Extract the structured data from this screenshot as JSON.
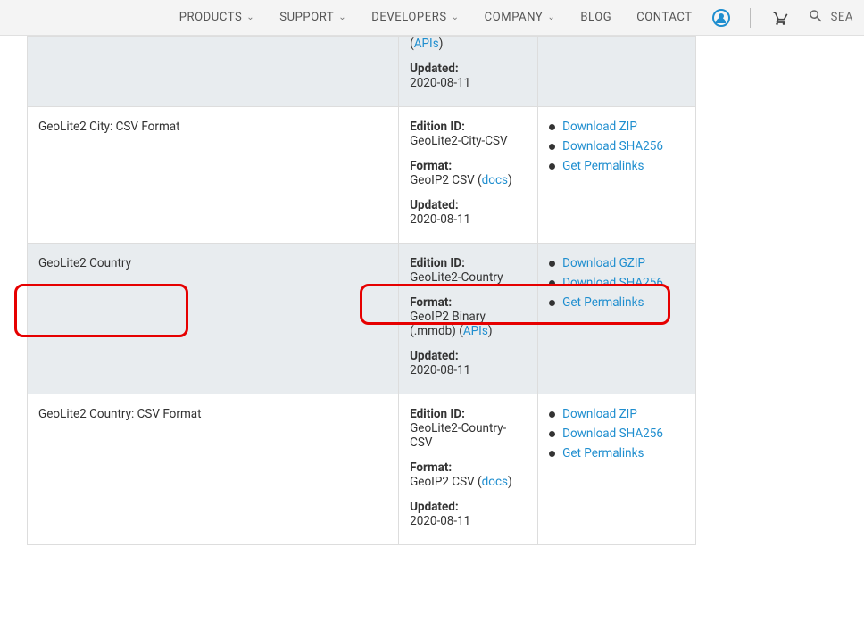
{
  "nav": {
    "products": "PRODUCTS",
    "support": "SUPPORT",
    "developers": "DEVELOPERS",
    "company": "COMPANY",
    "blog": "BLOG",
    "contact": "CONTACT",
    "search_placeholder": "SEA"
  },
  "labels": {
    "edition_id": "Edition ID:",
    "format": "Format:",
    "updated": "Updated:",
    "docs": "docs",
    "apis": "APIs",
    "download_zip": "Download ZIP",
    "download_gzip": "Download GZIP",
    "download_sha256": "Download SHA256",
    "get_permalinks": "Get Permalinks"
  },
  "rows": [
    {
      "name_hidden": true,
      "format_val_prefix_hidden": true,
      "edition_hidden": true,
      "apis_ref": true,
      "updated": "2020-08-11"
    },
    {
      "name": "GeoLite2 City: CSV Format",
      "edition": "GeoLite2-City-CSV",
      "format_val": "GeoIP2 CSV",
      "docs_ref": true,
      "updated": "2020-08-11",
      "actions": [
        "download_zip",
        "download_sha256",
        "get_permalinks"
      ]
    },
    {
      "name": "GeoLite2 Country",
      "edition": "GeoLite2-Country",
      "format_val": "GeoIP2 Binary (.mmdb)",
      "apis_ref": true,
      "updated": "2020-08-11",
      "actions": [
        "download_gzip",
        "download_sha256",
        "get_permalinks"
      ]
    },
    {
      "name": "GeoLite2 Country: CSV Format",
      "edition": "GeoLite2-Country-CSV",
      "format_val": "GeoIP2 CSV",
      "docs_ref": true,
      "updated": "2020-08-11",
      "actions": [
        "download_zip",
        "download_sha256",
        "get_permalinks"
      ]
    }
  ]
}
